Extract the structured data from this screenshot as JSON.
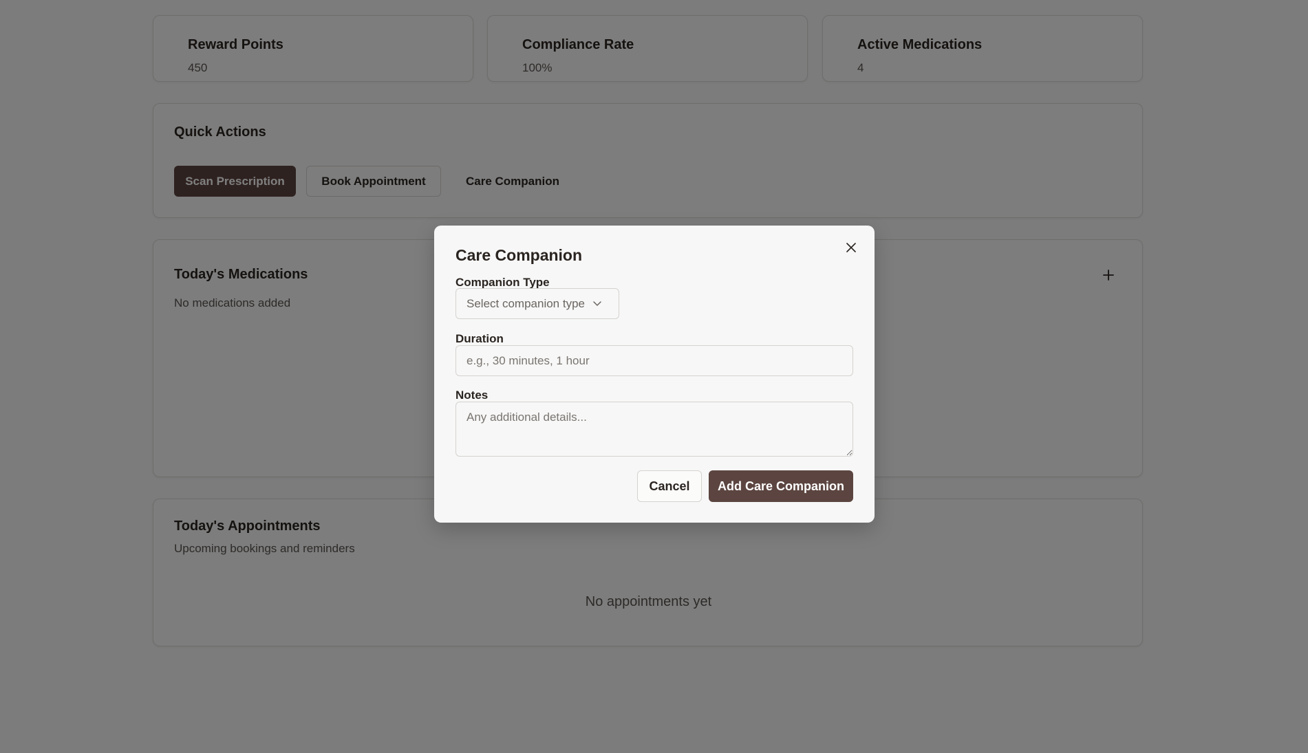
{
  "stats": [
    {
      "title": "Reward Points",
      "value": "450"
    },
    {
      "title": "Compliance Rate",
      "value": "100%"
    },
    {
      "title": "Active Medications",
      "value": "4"
    }
  ],
  "quick_actions": {
    "title": "Quick Actions",
    "buttons": [
      "Scan Prescription",
      "Book Appointment",
      "Care Companion"
    ]
  },
  "medications": {
    "title": "Today's Medications",
    "empty": "No medications added",
    "add_icon": "plus-icon"
  },
  "appointments": {
    "title": "Today's Appointments",
    "subtitle": "Upcoming bookings and reminders",
    "empty": "No appointments yet"
  },
  "modal": {
    "title": "Care Companion",
    "close_icon": "close-icon",
    "companion_type_label": "Companion Type",
    "companion_type_placeholder": "Select companion type",
    "duration_label": "Duration",
    "duration_placeholder": "e.g., 30 minutes, 1 hour",
    "notes_label": "Notes",
    "notes_placeholder": "Any additional details...",
    "cancel_label": "Cancel",
    "submit_label": "Add Care Companion"
  },
  "colors": {
    "primary": "#5c4540",
    "overlay": "rgba(0,0,0,0.5)",
    "background": "#f8f8f8"
  }
}
